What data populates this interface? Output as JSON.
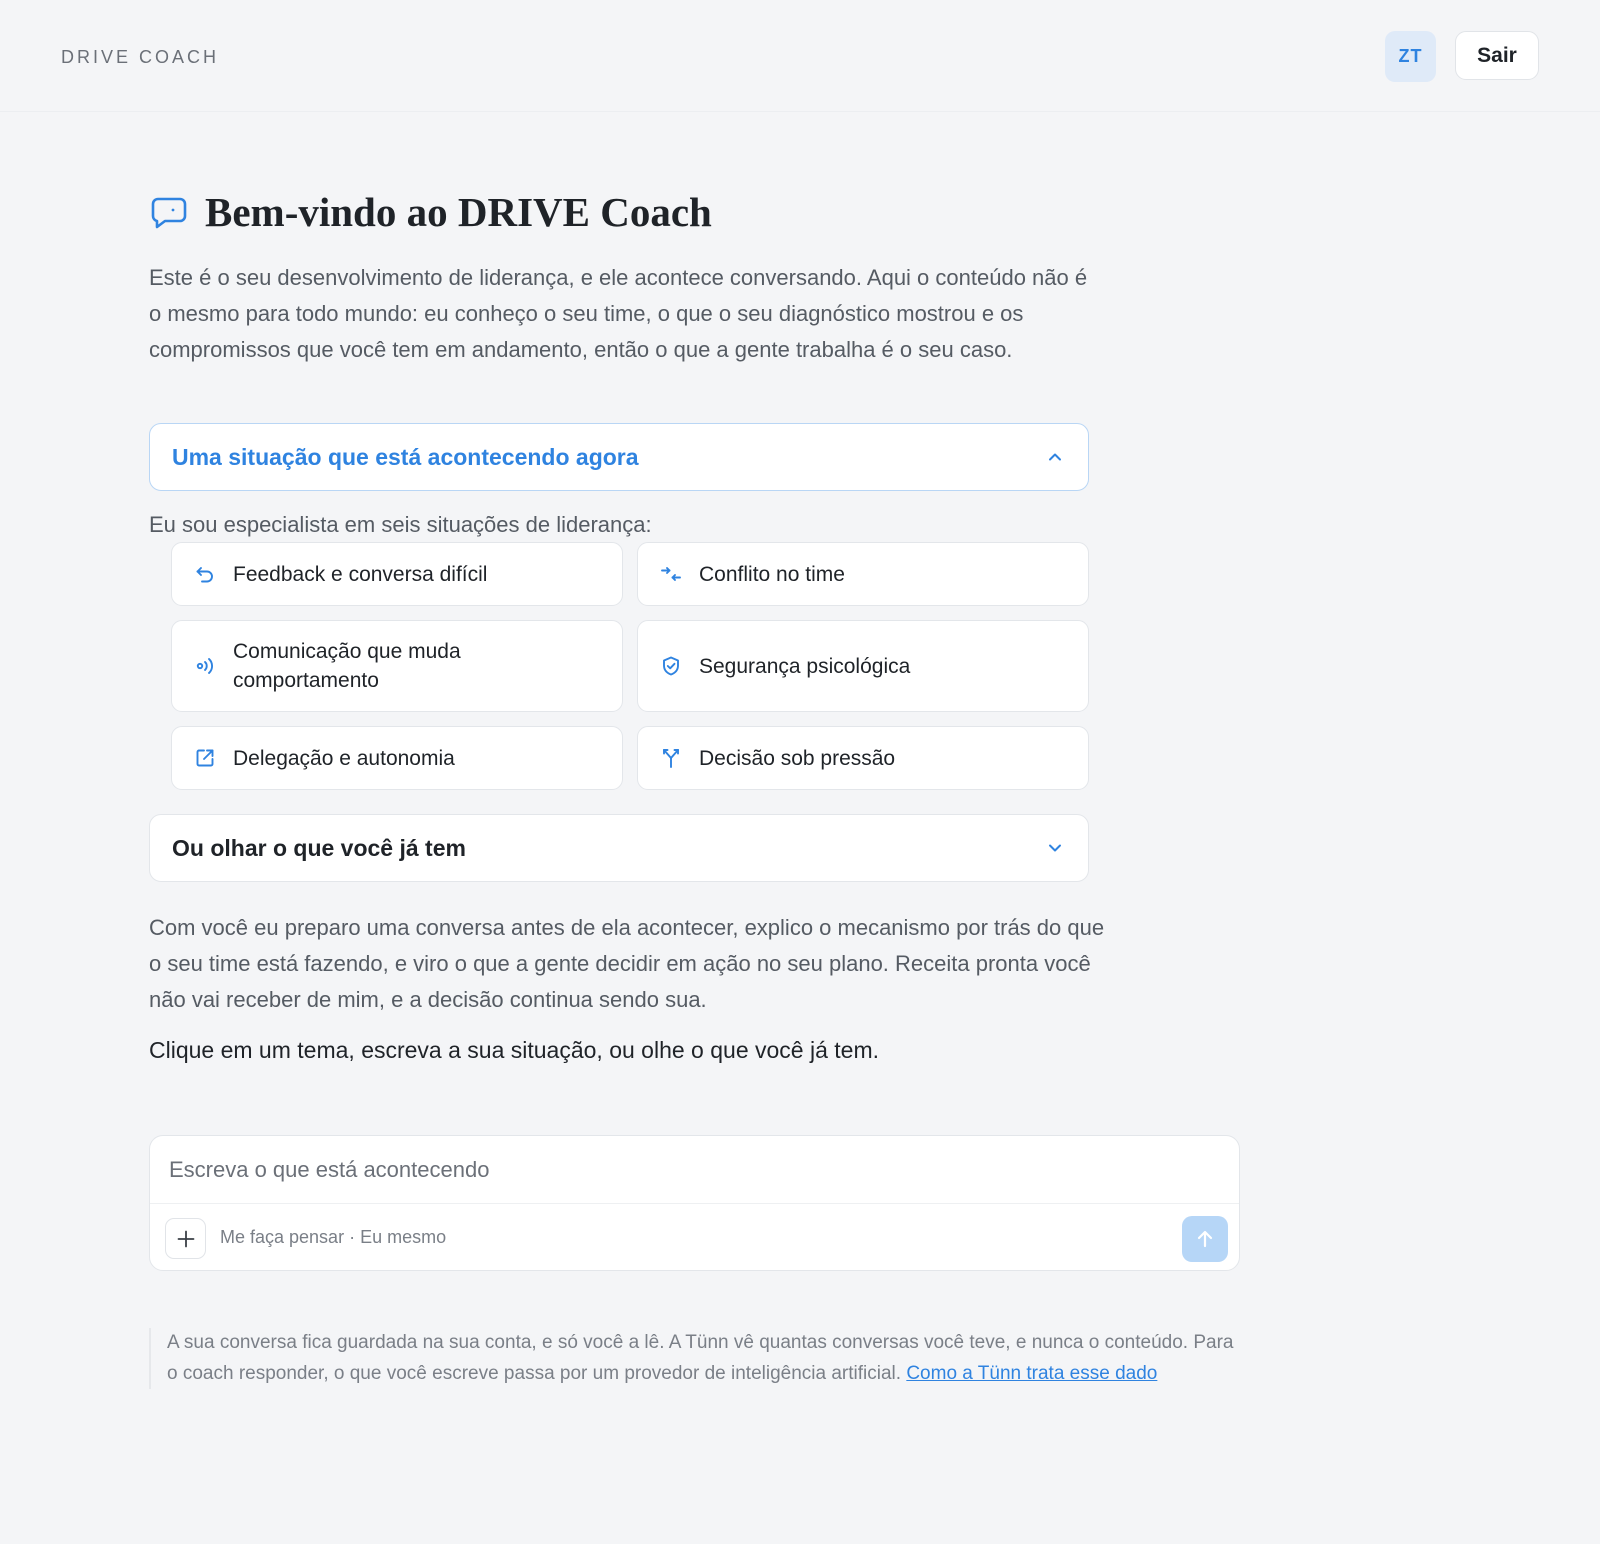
{
  "header": {
    "brand": "DRIVE COACH",
    "avatar_initials": "ZT",
    "logout_label": "Sair"
  },
  "welcome": {
    "title": "Bem-vindo ao DRIVE Coach",
    "intro": "Este é o seu desenvolvimento de liderança, e ele acontece conversando. Aqui o conteúdo não é o mesmo para todo mundo: eu conheço o seu time, o que o seu diagnóstico mostrou e os compromissos que você tem em andamento, então o que a gente trabalha é o seu caso."
  },
  "section_now": {
    "label": "Uma situação que está acontecendo agora",
    "expanded": true,
    "specialist_text": "Eu sou especialista em seis situações de liderança:",
    "topics": [
      {
        "label": "Feedback e conversa difícil",
        "icon": "return-arrow-icon"
      },
      {
        "label": "Conflito no time",
        "icon": "converge-arrows-icon"
      },
      {
        "label": "Comunicação que muda comportamento",
        "icon": "broadcast-icon"
      },
      {
        "label": "Segurança psicológica",
        "icon": "shield-check-icon"
      },
      {
        "label": "Delegação e autonomia",
        "icon": "external-link-icon"
      },
      {
        "label": "Decisão sob pressão",
        "icon": "split-branch-icon"
      }
    ]
  },
  "section_existing": {
    "label": "Ou olhar o que você já tem",
    "expanded": false
  },
  "description": "Com você eu preparo uma conversa antes de ela acontecer, explico o mecanismo por trás do que o seu time está fazendo, e viro o que a gente decidir em ação no seu plano. Receita pronta você não vai receber de mim, e a decisão continua sendo sua.",
  "cta": "Clique em um tema, escreva a sua situação, ou olhe o que você já tem.",
  "composer": {
    "placeholder": "Escreva o que está acontecendo",
    "value": "",
    "mode_text": "Me faça pensar · Eu mesmo"
  },
  "footnote": {
    "text": "A sua conversa fica guardada na sua conta, e só você a lê. A Tünn vê quantas conversas você teve, e nunca o conteúdo. Para o coach responder, o que você escreve passa por um provedor de inteligência artificial.",
    "link_label": "Como a Tünn trata esse dado"
  },
  "colors": {
    "accent": "#2f83e0",
    "background": "#f4f5f7",
    "send_button": "#b6d6f7"
  }
}
